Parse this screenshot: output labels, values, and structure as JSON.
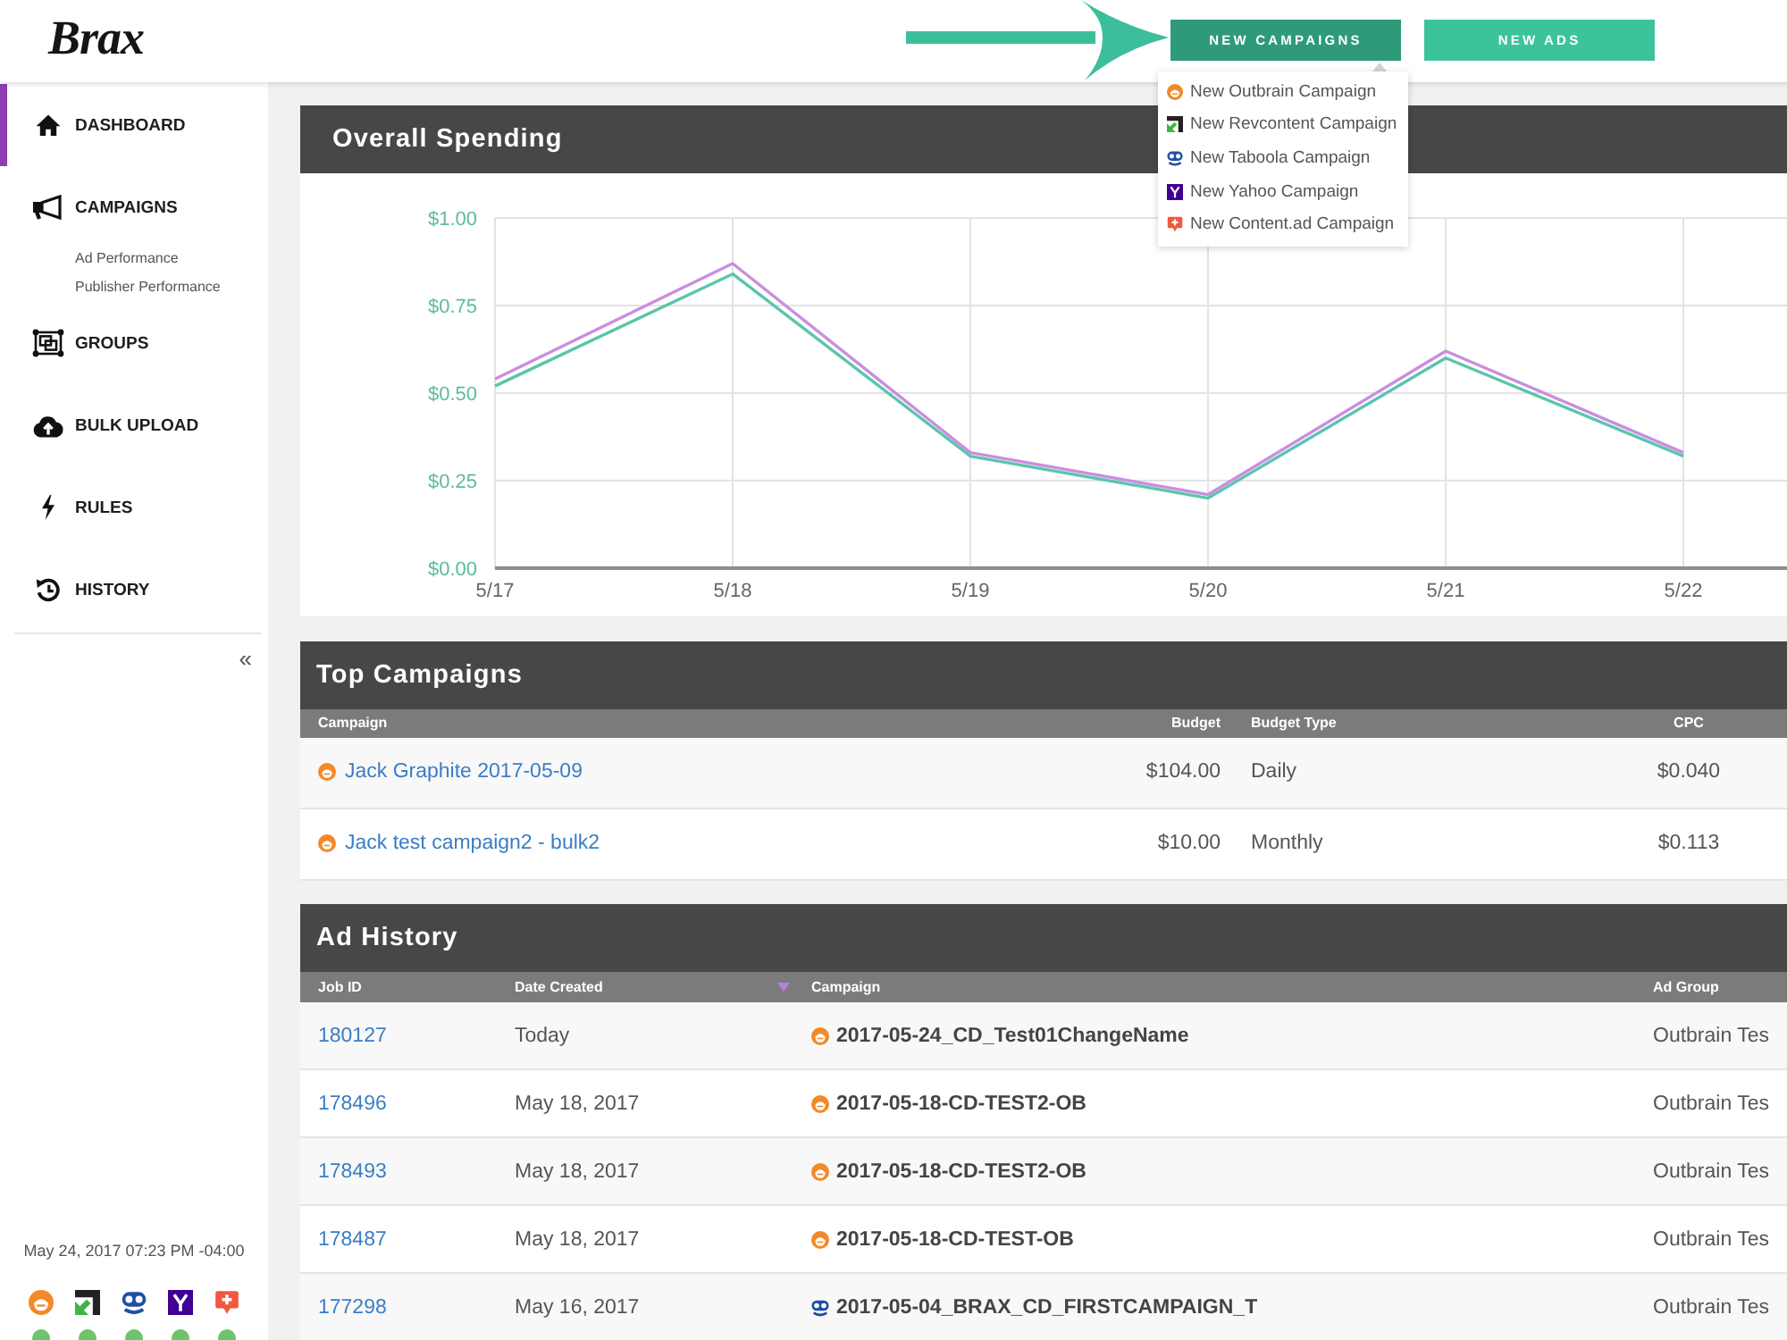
{
  "header": {
    "logo": "Brax",
    "buttons": [
      {
        "label": "NEW CAMPAIGNS",
        "expanded": true,
        "menu": [
          {
            "kind": "outbrain",
            "label": "New Outbrain Campaign"
          },
          {
            "kind": "revcontent",
            "label": "New Revcontent Campaign"
          },
          {
            "kind": "taboola",
            "label": "New Taboola Campaign"
          },
          {
            "kind": "yahoo",
            "label": "New Yahoo Campaign"
          },
          {
            "kind": "contentad",
            "label": "New Content.ad Campaign"
          }
        ]
      },
      {
        "label": "NEW ADS",
        "expanded": false
      }
    ]
  },
  "sidebar": {
    "items": [
      {
        "label": "DASHBOARD",
        "selected": true
      },
      {
        "label": "CAMPAIGNS",
        "selected": false,
        "children": [
          {
            "label": "Ad Performance",
            "selected": false
          },
          {
            "label": "Publisher Performance",
            "selected": false
          }
        ]
      },
      {
        "label": "GROUPS",
        "selected": false
      },
      {
        "label": "BULK UPLOAD",
        "selected": false
      },
      {
        "label": "RULES",
        "selected": false
      },
      {
        "label": "HISTORY",
        "selected": false
      }
    ],
    "collapse": "«",
    "timestamp": "May 24, 2017 07:23 PM -04:00",
    "providers": [
      {
        "kind": "outbrain"
      },
      {
        "kind": "revcontent"
      },
      {
        "kind": "taboola"
      },
      {
        "kind": "yahoo"
      },
      {
        "kind": "contentad"
      }
    ]
  },
  "panels": [
    {
      "kind": "chart",
      "title": "Overall Spending",
      "chart_data": {
        "type": "line",
        "grid": true,
        "categories": [
          "5/17",
          "5/18",
          "5/19",
          "5/20",
          "5/21",
          "5/22"
        ],
        "series": [
          {
            "color": "#c98ee0",
            "values": [
              0.54,
              0.87,
              0.33,
              0.21,
              0.62,
              0.33
            ]
          },
          {
            "color": "#5cc4ad",
            "values": [
              0.52,
              0.84,
              0.32,
              0.2,
              0.6,
              0.32
            ]
          }
        ],
        "ylim": [
          0,
          1
        ],
        "yticks": [
          {
            "value": 0,
            "label": "$0.00"
          },
          {
            "value": 0.25,
            "label": "$0.25"
          },
          {
            "value": 0.5,
            "label": "$0.50"
          },
          {
            "value": 0.75,
            "label": "$0.75"
          },
          {
            "value": 1,
            "label": "$1.00"
          }
        ]
      }
    },
    {
      "kind": "campaigns",
      "title": "Top Campaigns",
      "columns": [
        "Campaign",
        "Budget",
        "Budget Type",
        "CPC"
      ],
      "rows": [
        {
          "kind": "outbrain",
          "campaign": "Jack Graphite 2017-05-09",
          "budget": "$104.00",
          "budget_type": "Daily",
          "cpc": "$0.040"
        },
        {
          "kind": "outbrain",
          "campaign": "Jack test campaign2 - bulk2",
          "budget": "$10.00",
          "budget_type": "Monthly",
          "cpc": "$0.113"
        }
      ]
    },
    {
      "kind": "history",
      "title": "Ad History",
      "columns": [
        {
          "label": "Job ID",
          "sorted": false
        },
        {
          "label": "Date Created",
          "sorted": true
        },
        {
          "label": "Campaign",
          "sorted": false
        },
        {
          "label": "Ad Group",
          "sorted": false
        }
      ],
      "rows": [
        {
          "job_id": "180127",
          "date_created": "Today",
          "kind": "outbrain",
          "campaign": "2017-05-24_CD_Test01ChangeName",
          "ad_group": "Outbrain Tes"
        },
        {
          "job_id": "178496",
          "date_created": "May 18, 2017",
          "kind": "outbrain",
          "campaign": "2017-05-18-CD-TEST2-OB",
          "ad_group": "Outbrain Tes"
        },
        {
          "job_id": "178493",
          "date_created": "May 18, 2017",
          "kind": "outbrain",
          "campaign": "2017-05-18-CD-TEST2-OB",
          "ad_group": "Outbrain Tes"
        },
        {
          "job_id": "178487",
          "date_created": "May 18, 2017",
          "kind": "outbrain",
          "campaign": "2017-05-18-CD-TEST-OB",
          "ad_group": "Outbrain Tes"
        },
        {
          "job_id": "177298",
          "date_created": "May 16, 2017",
          "kind": "taboola",
          "campaign": "2017-05-04_BRAX_CD_FIRSTCAMPAIGN_T",
          "ad_group": "Outbrain Tes"
        }
      ]
    }
  ]
}
